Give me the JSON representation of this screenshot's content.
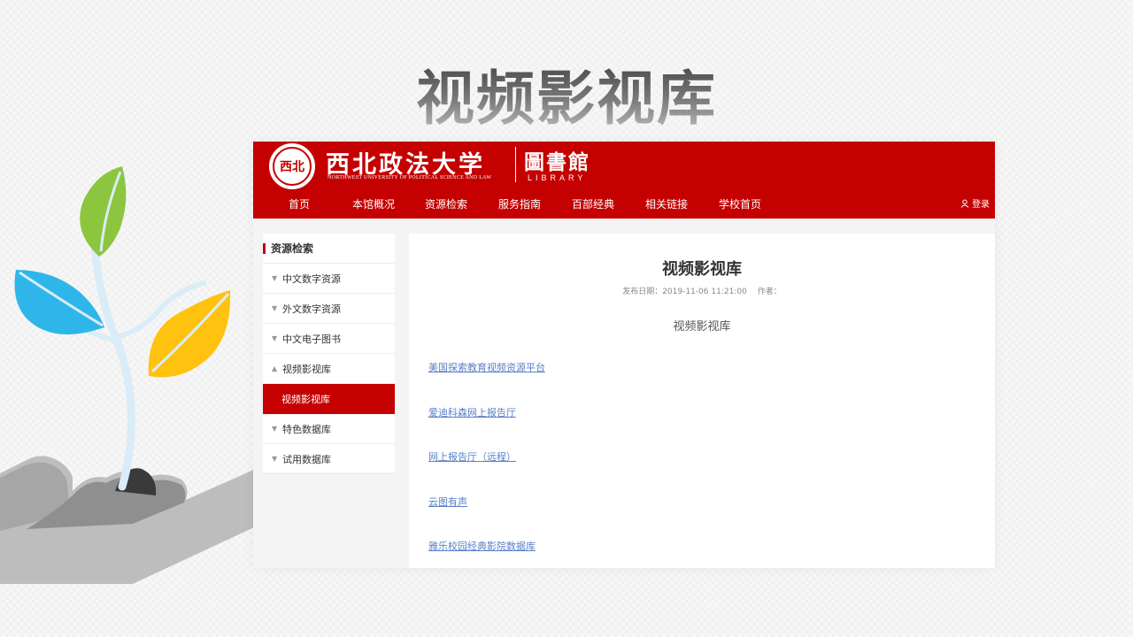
{
  "slide": {
    "title": "视频影视库"
  },
  "site": {
    "logo_seal_text": "西北",
    "name_cn": "西北政法大学",
    "name_en": "NORTHWEST UNIVERSITY OF POLITICAL SCIENCE AND LAW",
    "library_cn": "圖書館",
    "library_en": "LIBRARY",
    "brand_color": "#c40000",
    "nav": [
      "首页",
      "本馆概况",
      "资源检索",
      "服务指南",
      "百部经典",
      "相关链接",
      "学校首页"
    ],
    "login_label": "登录"
  },
  "sidebar": {
    "title": "资源检索",
    "items": [
      {
        "label": "中文数字资源",
        "icon": "triangle-down"
      },
      {
        "label": "外文数字资源",
        "icon": "triangle-down"
      },
      {
        "label": "中文电子图书",
        "icon": "triangle-down"
      },
      {
        "label": "视频影视库",
        "icon": "triangle-up"
      },
      {
        "label": "视频影视库",
        "active": true
      },
      {
        "label": "特色数据库",
        "icon": "triangle-down"
      },
      {
        "label": "试用数据库",
        "icon": "triangle-down"
      }
    ]
  },
  "article": {
    "title": "视频影视库",
    "date_label": "发布日期：",
    "date": "2019-11-06 11:21:00",
    "author_label": "作者：",
    "subtitle": "视频影视库",
    "links": [
      "美国探索教育视频资源平台",
      "爱迪科森网上报告厅",
      "网上报告厅（远程）",
      "云图有声",
      "雅乐校园经典影院数据库"
    ]
  },
  "illustration": {
    "leaf_colors": [
      "#8cc63f",
      "#2eb6ea",
      "#ffc20e"
    ],
    "hand_color": "#b3b3b3"
  }
}
